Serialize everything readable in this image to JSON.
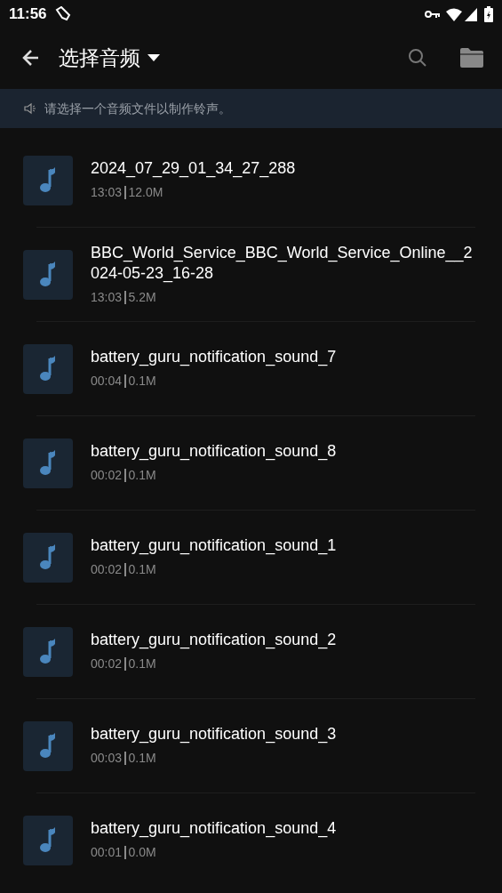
{
  "status_bar": {
    "time": "11:56"
  },
  "app_bar": {
    "title": "选择音频"
  },
  "banner": {
    "text": "请选择一个音频文件以制作铃声。"
  },
  "files": [
    {
      "name": "2024_07_29_01_34_27_288",
      "duration": "13:03",
      "size": "12.0M"
    },
    {
      "name": "BBC_World_Service_BBC_World_Service_Online__2024-05-23_16-28",
      "duration": "13:03",
      "size": "5.2M"
    },
    {
      "name": "battery_guru_notification_sound_7",
      "duration": "00:04",
      "size": "0.1M"
    },
    {
      "name": "battery_guru_notification_sound_8",
      "duration": "00:02",
      "size": "0.1M"
    },
    {
      "name": "battery_guru_notification_sound_1",
      "duration": "00:02",
      "size": "0.1M"
    },
    {
      "name": "battery_guru_notification_sound_2",
      "duration": "00:02",
      "size": "0.1M"
    },
    {
      "name": "battery_guru_notification_sound_3",
      "duration": "00:03",
      "size": "0.1M"
    },
    {
      "name": "battery_guru_notification_sound_4",
      "duration": "00:01",
      "size": "0.0M"
    }
  ]
}
